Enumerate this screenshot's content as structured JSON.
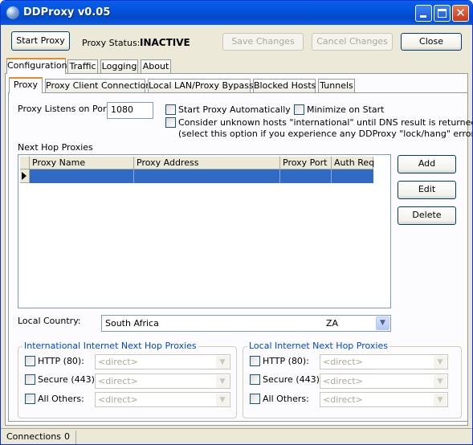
{
  "window": {
    "title": "DDProxy v0.05"
  },
  "toolbar": {
    "start_proxy": "Start Proxy",
    "proxy_status_label": "Proxy Status:",
    "proxy_status_value": "INACTIVE",
    "save_changes": "Save Changes",
    "cancel_changes": "Cancel Changes",
    "close": "Close"
  },
  "main_tabs": [
    "Configuration",
    "Traffic",
    "Logging",
    "About"
  ],
  "sub_tabs": [
    "Proxy",
    "Proxy Client Connections",
    "Local LAN/Proxy Bypass",
    "Blocked Hosts",
    "Tunnels"
  ],
  "proxy": {
    "port_label": "Proxy Listens on Port:",
    "port_value": "1080",
    "start_auto_label": "Start Proxy Automatically",
    "minimize_label": "Minimize on Start",
    "consider_label": "Consider unknown hosts \"international\" until DNS result is returned",
    "consider_hint": "(select this option if you experience any DDProxy \"lock/hang\" errors)"
  },
  "next_hop": {
    "label": "Next Hop Proxies",
    "columns": [
      "Proxy Name",
      "Proxy Address",
      "Proxy Port",
      "Auth Req"
    ],
    "add": "Add",
    "edit": "Edit",
    "delete": "Delete"
  },
  "country": {
    "label": "Local Country:",
    "name": "South Africa",
    "code": "ZA"
  },
  "intl_group": {
    "title": "International Internet Next Hop Proxies",
    "http": "HTTP (80):",
    "secure": "Secure (443):",
    "others": "All Others:",
    "placeholder": "<direct>"
  },
  "local_group": {
    "title": "Local Internet Next Hop Proxies",
    "http": "HTTP (80):",
    "secure": "Secure (443):",
    "others": "All Others:",
    "placeholder": "<direct>"
  },
  "status": {
    "connections_label": "Connections",
    "connections_value": "0"
  }
}
